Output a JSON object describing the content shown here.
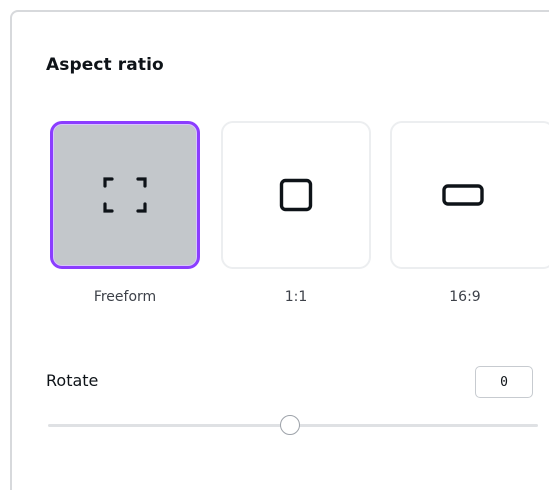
{
  "aspect_ratio": {
    "title": "Aspect ratio",
    "selected_index": 0,
    "options": [
      {
        "label": "Freeform",
        "icon": "freeform-crop-icon"
      },
      {
        "label": "1:1",
        "icon": "square-icon"
      },
      {
        "label": "16:9",
        "icon": "widescreen-rectangle-icon"
      }
    ],
    "accent_color": "#8b3dff"
  },
  "rotate": {
    "label": "Rotate",
    "value": "0",
    "slider_min": -180,
    "slider_max": 180,
    "slider_value": 0
  }
}
